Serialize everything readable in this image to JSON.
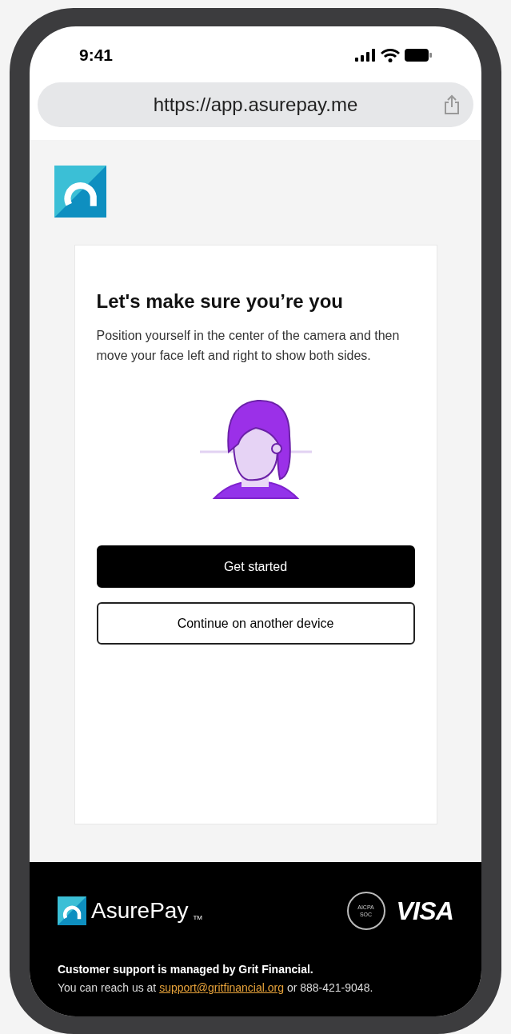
{
  "status_bar": {
    "time": "9:41"
  },
  "browser": {
    "url": "https://app.asurepay.me"
  },
  "card": {
    "title": "Let's make sure you’re you",
    "description": "Position yourself in the center of the camera and then move your face left and right to show both sides.",
    "buttons": [
      {
        "label": "Get started",
        "kind": "primary"
      },
      {
        "label": "Continue on another device",
        "kind": "secondary"
      }
    ]
  },
  "footer": {
    "brand": "AsurePay",
    "trademark": "TM",
    "badge_lines": [
      "AICPA",
      "SOC"
    ],
    "card_network": "VISA",
    "support_heading": "Customer support is managed by Grit Financial.",
    "support_before": "You can reach us at ",
    "support_email": "support@gritfinancial.org",
    "support_after": " or 888-421-9048."
  }
}
